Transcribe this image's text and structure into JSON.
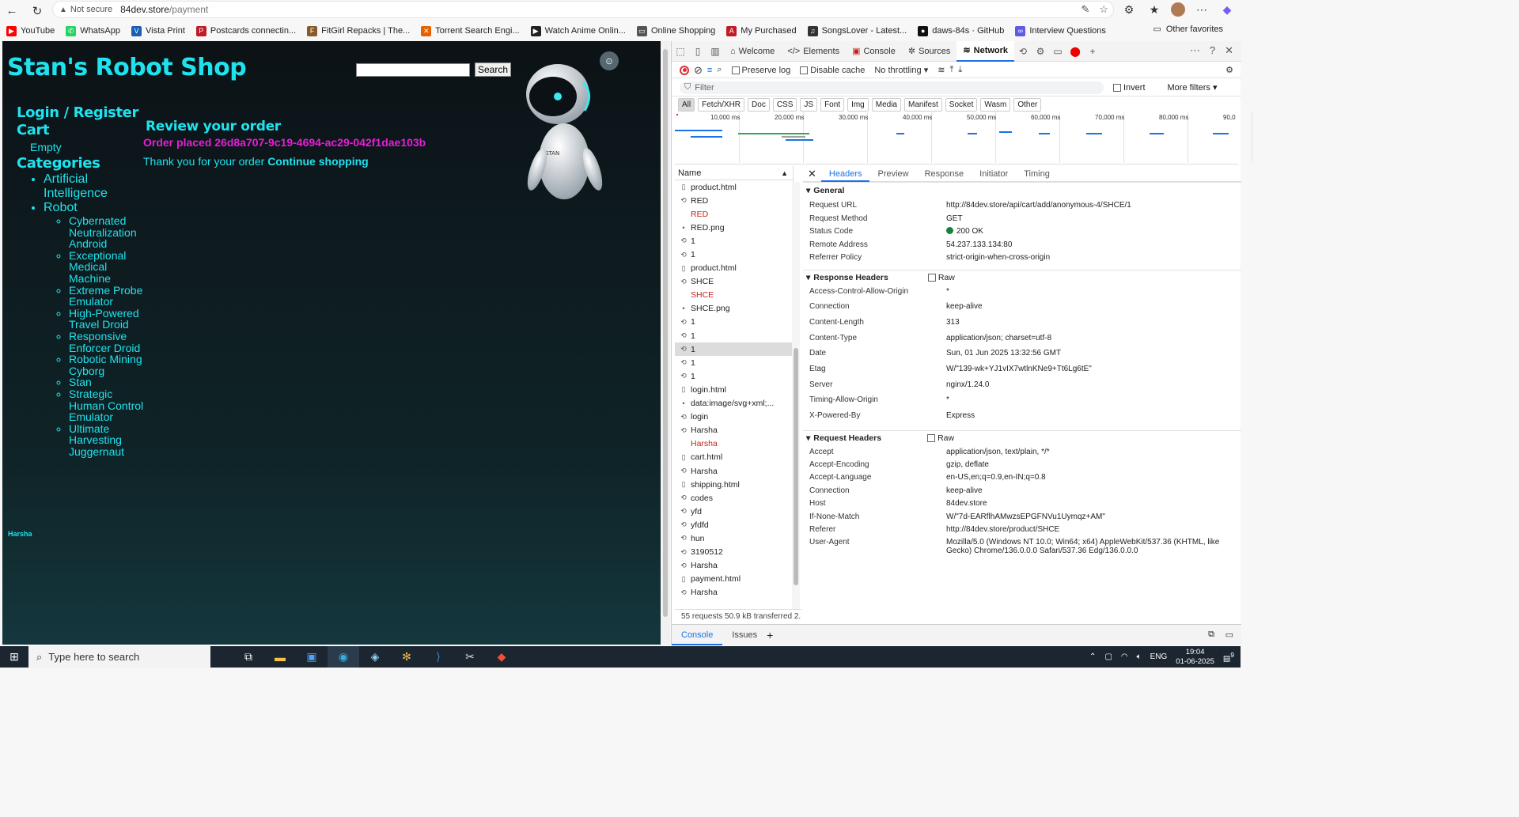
{
  "browser": {
    "not_secure": "Not secure",
    "url_host": "84dev.store",
    "url_path": "/payment"
  },
  "bookmarks": [
    {
      "label": "YouTube",
      "color": "#ff0000",
      "glyph": "▶"
    },
    {
      "label": "WhatsApp",
      "color": "#25d366",
      "glyph": "✆"
    },
    {
      "label": "Vista Print",
      "color": "#1a5fb4",
      "glyph": "V"
    },
    {
      "label": "Postcards connectin...",
      "color": "#c01c28",
      "glyph": "P"
    },
    {
      "label": "FitGirl Repacks | The...",
      "color": "#8a5a2b",
      "glyph": "F"
    },
    {
      "label": "Torrent Search Engi...",
      "color": "#e66100",
      "glyph": "✕"
    },
    {
      "label": "Watch Anime Onlin...",
      "color": "#222222",
      "glyph": "▶"
    },
    {
      "label": "Online Shopping",
      "color": "#555555",
      "glyph": "▭"
    },
    {
      "label": "My Purchased",
      "color": "#c01c28",
      "glyph": "A"
    },
    {
      "label": "SongsLover - Latest...",
      "color": "#333333",
      "glyph": "♫"
    },
    {
      "label": "daws-84s · GitHub",
      "color": "#111111",
      "glyph": "●"
    },
    {
      "label": "Interview Questions",
      "color": "#5e5ce6",
      "glyph": "∞"
    }
  ],
  "other_favorites": "Other favorites",
  "shop": {
    "title": "Stan's Robot Shop",
    "search_button": "Search",
    "search_value": "",
    "nav": {
      "login": "Login / Register",
      "cart": "Cart",
      "cart_status": "Empty",
      "categories": "Categories",
      "cat_ai": "Artificial Intelligence",
      "cat_robot": "Robot",
      "robots": [
        "Cybernated Neutralization Android",
        "Exceptional Medical Machine",
        "Extreme Probe Emulator",
        "High-Powered Travel Droid",
        "Responsive Enforcer Droid",
        "Robotic Mining Cyborg",
        "Stan",
        "Strategic Human Control Emulator",
        "Ultimate Harvesting Juggernaut"
      ]
    },
    "user": "Harsha",
    "review_title": "Review your order",
    "order_placed": "Order placed 26d8a707-9c19-4694-ac29-042f1dae103b",
    "thanks": "Thank you for your order",
    "continue": "Continue shopping",
    "robot_label": "STAN"
  },
  "devtools": {
    "tabs": [
      "Welcome",
      "Elements",
      "Console",
      "Sources",
      "Network"
    ],
    "active_tab": "Network",
    "preserve_log": "Preserve log",
    "disable_cache": "Disable cache",
    "throttling": "No throttling",
    "filter_placeholder": "Filter",
    "invert": "Invert",
    "more_filters": "More filters",
    "types": [
      "All",
      "Fetch/XHR",
      "Doc",
      "CSS",
      "JS",
      "Font",
      "Img",
      "Media",
      "Manifest",
      "Socket",
      "Wasm",
      "Other"
    ],
    "ticks": [
      "10,000 ms",
      "20,000 ms",
      "30,000 ms",
      "40,000 ms",
      "50,000 ms",
      "60,000 ms",
      "70,000 ms",
      "80,000 ms",
      "90,0"
    ],
    "name_header": "Name",
    "requests": [
      {
        "name": "product.html",
        "icon": "doc",
        "red": false
      },
      {
        "name": "RED",
        "icon": "xhr",
        "red": false
      },
      {
        "name": "RED",
        "icon": "none",
        "red": true
      },
      {
        "name": "RED.png",
        "icon": "img",
        "red": false
      },
      {
        "name": "1",
        "icon": "xhr",
        "red": false
      },
      {
        "name": "1",
        "icon": "xhr",
        "red": false
      },
      {
        "name": "product.html",
        "icon": "doc",
        "red": false
      },
      {
        "name": "SHCE",
        "icon": "xhr",
        "red": false
      },
      {
        "name": "SHCE",
        "icon": "none",
        "red": true
      },
      {
        "name": "SHCE.png",
        "icon": "img",
        "red": false
      },
      {
        "name": "1",
        "icon": "xhr",
        "red": false
      },
      {
        "name": "1",
        "icon": "xhr",
        "red": false
      },
      {
        "name": "1",
        "icon": "xhr",
        "red": false,
        "selected": true
      },
      {
        "name": "1",
        "icon": "xhr",
        "red": false
      },
      {
        "name": "1",
        "icon": "xhr",
        "red": false
      },
      {
        "name": "login.html",
        "icon": "doc",
        "red": false
      },
      {
        "name": "data:image/svg+xml;...",
        "icon": "img",
        "red": false
      },
      {
        "name": "login",
        "icon": "xhr",
        "red": false
      },
      {
        "name": "Harsha",
        "icon": "xhr",
        "red": false
      },
      {
        "name": "Harsha",
        "icon": "none",
        "red": true
      },
      {
        "name": "cart.html",
        "icon": "doc",
        "red": false
      },
      {
        "name": "Harsha",
        "icon": "xhr",
        "red": false
      },
      {
        "name": "shipping.html",
        "icon": "doc",
        "red": false
      },
      {
        "name": "codes",
        "icon": "xhr",
        "red": false
      },
      {
        "name": "yfd",
        "icon": "xhr",
        "red": false
      },
      {
        "name": "yfdfd",
        "icon": "xhr",
        "red": false
      },
      {
        "name": "hun",
        "icon": "xhr",
        "red": false
      },
      {
        "name": "3190512",
        "icon": "xhr",
        "red": false
      },
      {
        "name": "Harsha",
        "icon": "xhr",
        "red": false
      },
      {
        "name": "payment.html",
        "icon": "doc",
        "red": false
      },
      {
        "name": "Harsha",
        "icon": "xhr",
        "red": false
      }
    ],
    "status_bar": "55 requests  50.9 kB transferred  2.",
    "detail_tabs": [
      "Headers",
      "Preview",
      "Response",
      "Initiator",
      "Timing"
    ],
    "general_title": "General",
    "general": [
      {
        "k": "Request URL",
        "v": "http://84dev.store/api/cart/add/anonymous-4/SHCE/1"
      },
      {
        "k": "Request Method",
        "v": "GET"
      },
      {
        "k": "Status Code",
        "v": "200 OK"
      },
      {
        "k": "Remote Address",
        "v": "54.237.133.134:80"
      },
      {
        "k": "Referrer Policy",
        "v": "strict-origin-when-cross-origin"
      }
    ],
    "response_title": "Response Headers",
    "raw": "Raw",
    "response_headers": [
      {
        "k": "Access-Control-Allow-Origin",
        "v": "*"
      },
      {
        "k": "Connection",
        "v": "keep-alive"
      },
      {
        "k": "Content-Length",
        "v": "313"
      },
      {
        "k": "Content-Type",
        "v": "application/json; charset=utf-8"
      },
      {
        "k": "Date",
        "v": "Sun, 01 Jun 2025 13:32:56 GMT"
      },
      {
        "k": "Etag",
        "v": "W/\"139-wk+YJ1vIX7wtlnKNe9+Tt6Lg6tE\""
      },
      {
        "k": "Server",
        "v": "nginx/1.24.0"
      },
      {
        "k": "Timing-Allow-Origin",
        "v": "*"
      },
      {
        "k": "X-Powered-By",
        "v": "Express"
      }
    ],
    "request_title": "Request Headers",
    "request_headers": [
      {
        "k": "Accept",
        "v": "application/json, text/plain, */*"
      },
      {
        "k": "Accept-Encoding",
        "v": "gzip, deflate"
      },
      {
        "k": "Accept-Language",
        "v": "en-US,en;q=0.9,en-IN;q=0.8"
      },
      {
        "k": "Connection",
        "v": "keep-alive"
      },
      {
        "k": "Host",
        "v": "84dev.store"
      },
      {
        "k": "If-None-Match",
        "v": "W/\"7d-EARflhAMwzsEPGFNVu1Uymqz+AM\""
      },
      {
        "k": "Referer",
        "v": "http://84dev.store/product/SHCE"
      },
      {
        "k": "User-Agent",
        "v": "Mozilla/5.0 (Windows NT 10.0; Win64; x64) AppleWebKit/537.36 (KHTML, like Gecko) Chrome/136.0.0.0 Safari/537.36 Edg/136.0.0.0"
      }
    ],
    "drawer_tabs": [
      "Console",
      "Issues"
    ]
  },
  "taskbar": {
    "search_placeholder": "Type here to search",
    "lang": "ENG",
    "time": "19:04",
    "date": "01-06-2025",
    "notif_count": "9"
  }
}
